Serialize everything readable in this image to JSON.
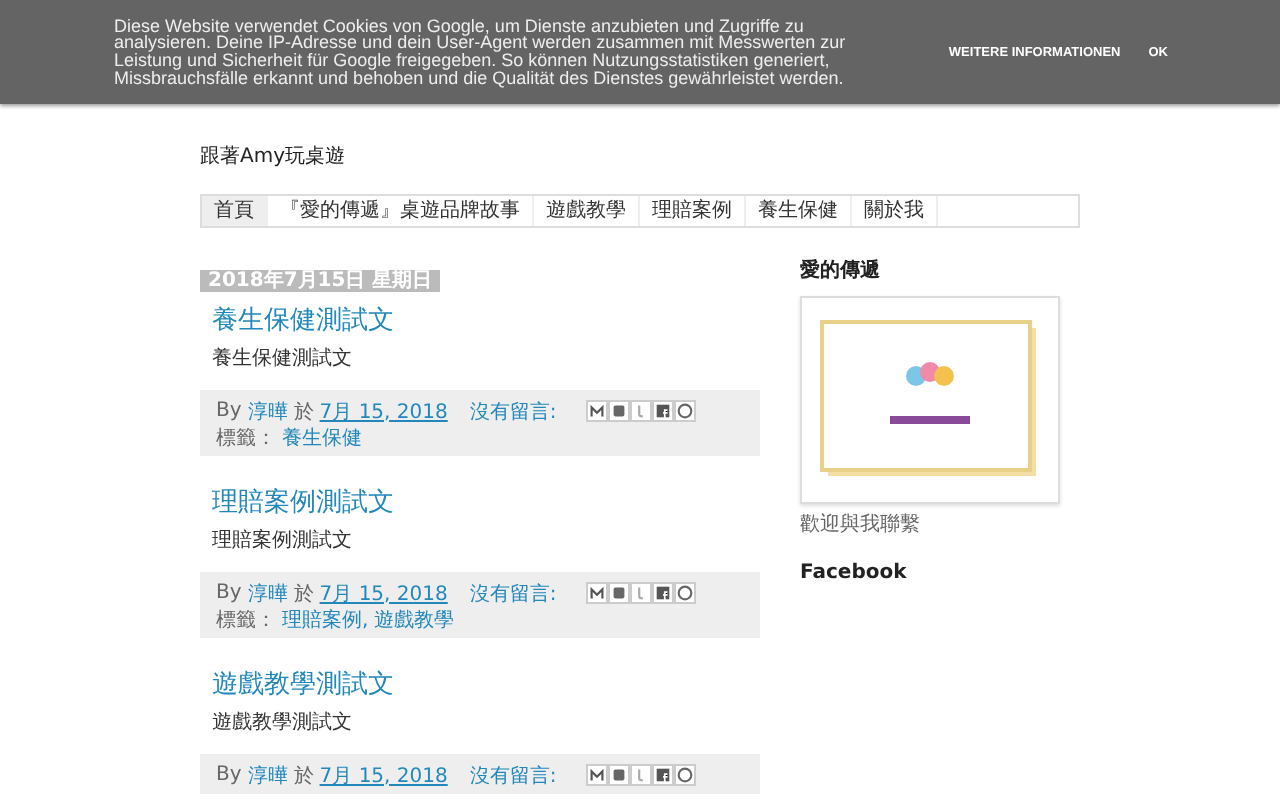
{
  "cookie_banner": {
    "message": "Diese Website verwendet Cookies von Google, um Dienste anzubieten und Zugriffe zu analysieren. Deine IP-Adresse und dein User-Agent werden zusammen mit Messwerten zur Leistung und Sicherheit für Google freigegeben. So können Nutzungsstatistiken generiert, Missbrauchsfälle erkannt und behoben und die Qualität des Dienstes gewährleistet werden.",
    "buttons": [
      "WEITERE INFORMATIONEN",
      "OK"
    ]
  },
  "blog": {
    "description": "跟著Amy玩桌遊"
  },
  "nav": [
    {
      "label": "首頁",
      "selected": true
    },
    {
      "label": "『愛的傳遞』桌遊品牌故事",
      "selected": false
    },
    {
      "label": "遊戲教學",
      "selected": false
    },
    {
      "label": "理賠案例",
      "selected": false
    },
    {
      "label": "養生保健",
      "selected": false
    },
    {
      "label": "關於我",
      "selected": false
    }
  ],
  "date_header": "2018年7月15日 星期日",
  "posts": [
    {
      "title": "養生保健測試文",
      "body": "養生保健測試文",
      "by": "By",
      "author": "淳曄",
      "at": "於",
      "date": "7月 15, 2018",
      "comments": "沒有留言:",
      "labels_caption": "標籤：",
      "labels": [
        "養生保健"
      ]
    },
    {
      "title": "理賠案例測試文",
      "body": "理賠案例測試文",
      "by": "By",
      "author": "淳曄",
      "at": "於",
      "date": "7月 15, 2018",
      "comments": "沒有留言:",
      "labels_caption": "標籤：",
      "labels": [
        "理賠案例,",
        "遊戲教學"
      ]
    },
    {
      "title": "遊戲教學測試文",
      "body": "遊戲教學測試文",
      "by": "By",
      "author": "淳曄",
      "at": "於",
      "date": "7月 15, 2018",
      "comments": "沒有留言:"
    }
  ],
  "sidebar": {
    "widgets": [
      {
        "kind": "image",
        "title": "愛的傳遞",
        "caption": "歡迎與我聯繫"
      },
      {
        "kind": "heading",
        "title": "Facebook"
      }
    ]
  }
}
